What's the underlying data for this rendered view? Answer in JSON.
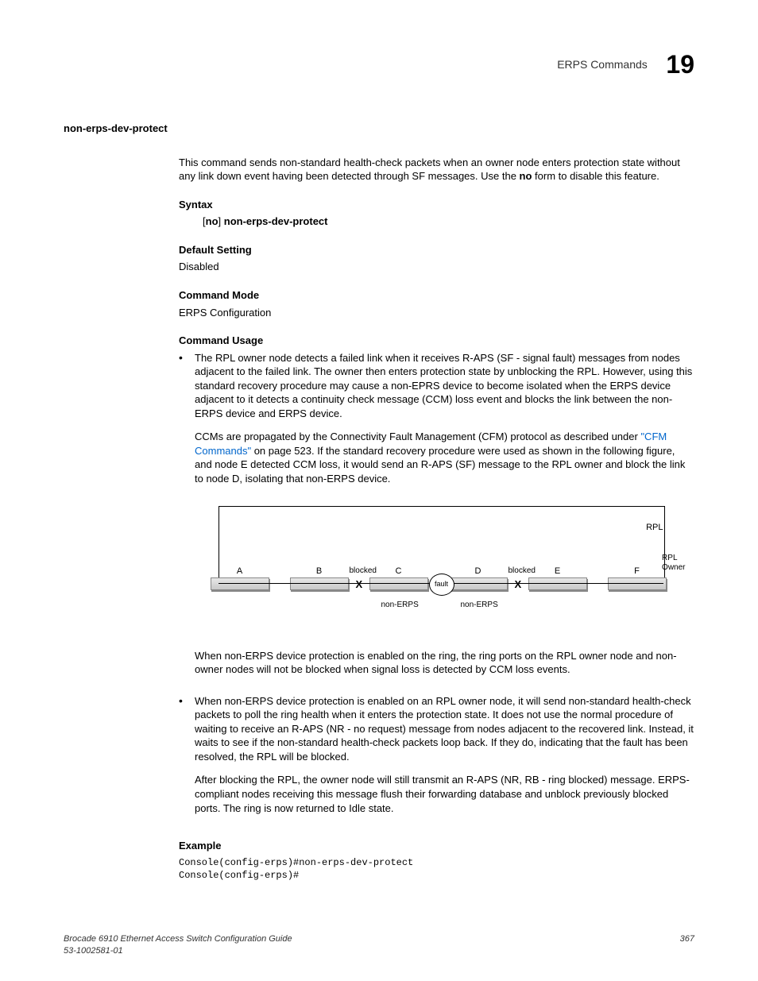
{
  "header": {
    "section": "ERPS Commands",
    "chapter": "19"
  },
  "cmd_name": "non-erps-dev-protect",
  "intro": "This command sends non-standard health-check packets when an owner node enters protection state without any link down event having been detected through SF messages. Use the no form to disable this feature.",
  "syntax": {
    "title": "Syntax",
    "line": "[no] non-erps-dev-protect"
  },
  "default_setting": {
    "title": "Default Setting",
    "value": "Disabled"
  },
  "command_mode": {
    "title": "Command Mode",
    "value": "ERPS Configuration"
  },
  "command_usage": {
    "title": "Command Usage",
    "b1p1": "The RPL owner node detects a failed link when it receives R-APS (SF - signal fault) messages from nodes adjacent to the failed link. The owner then enters protection state by unblocking the RPL. However, using this standard recovery procedure may cause a non-EPRS device to become isolated when the ERPS device adjacent to it detects a continuity check message (CCM) loss event and blocks the link between the non-ERPS device and ERPS device.",
    "b1p2a": "CCMs are propagated by the Connectivity Fault Management (CFM) protocol as described under ",
    "b1p2link": "\"CFM Commands\"",
    "b1p2b": " on page 523. If the standard recovery procedure were used as shown in the following figure, and node E detected CCM loss, it would send an R-APS (SF) message to the RPL owner and block the link to node D, isolating that non-ERPS device.",
    "b1p3": "When non-ERPS device protection is enabled on the ring, the ring ports on the RPL owner node and non-owner nodes will not be blocked when signal loss is detected by CCM loss events.",
    "b2p1": "When non-ERPS device protection is enabled on an RPL owner node, it will send non-standard health-check packets to poll the ring health when it enters the protection state. It does not use the normal procedure of waiting to receive an R-APS (NR - no request) message from nodes adjacent to the recovered link. Instead, it waits to see if the non-standard health-check packets loop back. If they do, indicating that the fault has been resolved, the RPL will be blocked.",
    "b2p2": "After blocking the RPL, the owner node will still transmit an R-APS (NR, RB - ring blocked) message. ERPS-compliant nodes receiving this message flush their forwarding database and unblock previously blocked ports. The ring is now returned to Idle state."
  },
  "example": {
    "title": "Example",
    "code": "Console(config-erps)#non-erps-dev-protect\nConsole(config-erps)#"
  },
  "diagram": {
    "rpl": "RPL",
    "rpl_owner_l1": "RPL",
    "rpl_owner_l2": "Owner",
    "nodes": {
      "a": "A",
      "b": "B",
      "c": "C",
      "d": "D",
      "e": "E",
      "f": "F"
    },
    "blocked": "blocked",
    "fault": "fault",
    "non_erps": "non-ERPS",
    "x": "X"
  },
  "footer": {
    "left1": "Brocade 6910 Ethernet Access Switch Configuration Guide",
    "left2": "53-1002581-01",
    "right": "367"
  }
}
